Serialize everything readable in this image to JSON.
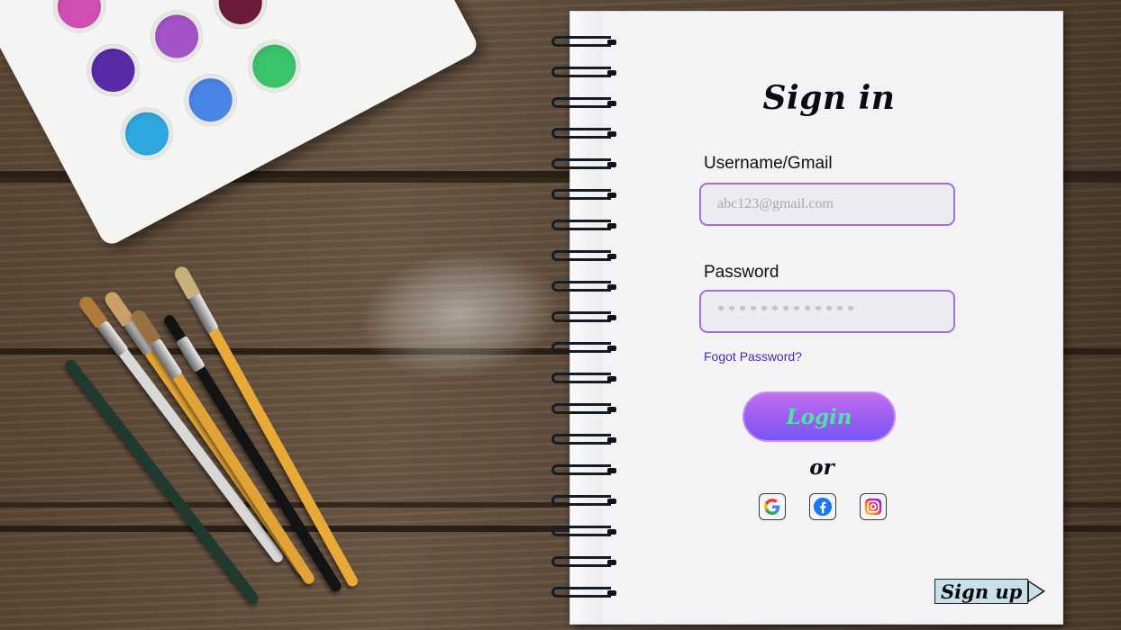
{
  "form": {
    "title": "Sign in",
    "username_label": "Username/Gmail",
    "username_placeholder": "abc123@gmail.com",
    "password_label": "Password",
    "password_placeholder": "*************",
    "forgot_link": "Fogot Password?",
    "login_button": "Login",
    "or_text": "or",
    "signup_link": "Sign up"
  },
  "social": [
    {
      "name": "google-icon"
    },
    {
      "name": "facebook-icon"
    },
    {
      "name": "instagram-icon"
    }
  ],
  "colors": {
    "input_border": "#a56be0",
    "login_gradient_top": "#c26ff0",
    "login_gradient_bottom": "#7658f5",
    "login_text": "#4fe3a0",
    "forgot_link": "#3b34a8"
  }
}
